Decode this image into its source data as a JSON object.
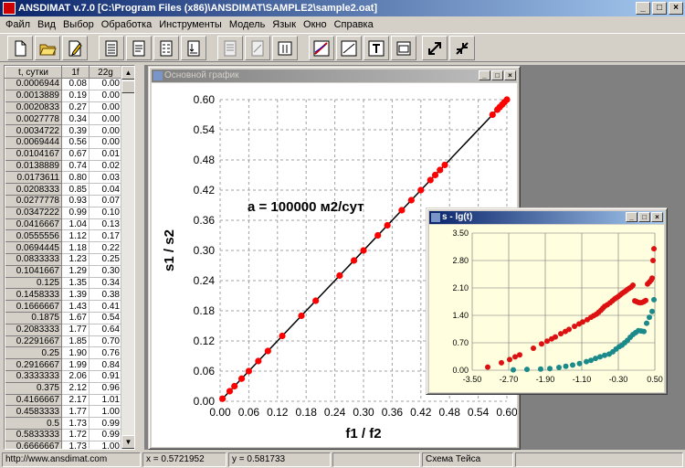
{
  "app": {
    "title": "ANSDIMAT v.7.0  [C:\\Program Files (x86)\\ANSDIMAT\\SAMPLE2\\sample2.oat]",
    "window_buttons": {
      "minimize": "_",
      "maximize": "□",
      "close": "×"
    }
  },
  "menu": [
    "Файл",
    "Вид",
    "Выбор",
    "Обработка",
    "Инструменты",
    "Модель",
    "Язык",
    "Окно",
    "Справка"
  ],
  "toolbar": {
    "buttons": [
      {
        "icon": "new-file-icon"
      },
      {
        "icon": "open-folder-icon"
      },
      {
        "icon": "edit-icon"
      },
      {
        "icon": "table-icon"
      },
      {
        "icon": "doc-icon"
      },
      {
        "icon": "list-icon"
      },
      {
        "icon": "print-icon"
      },
      {
        "icon": "copy-icon"
      },
      {
        "icon": "format-icon"
      },
      {
        "icon": "columns-icon"
      },
      {
        "icon": "chart-icon"
      },
      {
        "icon": "line-icon"
      },
      {
        "icon": "text-icon"
      },
      {
        "icon": "window-icon"
      },
      {
        "icon": "expand-icon"
      },
      {
        "icon": "shrink-icon"
      }
    ]
  },
  "table": {
    "headers": [
      "t, сутки",
      "1f",
      "22g"
    ],
    "rows": [
      [
        "0.0006944",
        "0.08",
        "0.00"
      ],
      [
        "0.0013889",
        "0.19",
        "0.00"
      ],
      [
        "0.0020833",
        "0.27",
        "0.00"
      ],
      [
        "0.0027778",
        "0.34",
        "0.00"
      ],
      [
        "0.0034722",
        "0.39",
        "0.00"
      ],
      [
        "0.0069444",
        "0.56",
        "0.00"
      ],
      [
        "0.0104167",
        "0.67",
        "0.01"
      ],
      [
        "0.0138889",
        "0.74",
        "0.02"
      ],
      [
        "0.0173611",
        "0.80",
        "0.03"
      ],
      [
        "0.0208333",
        "0.85",
        "0.04"
      ],
      [
        "0.0277778",
        "0.93",
        "0.07"
      ],
      [
        "0.0347222",
        "0.99",
        "0.10"
      ],
      [
        "0.0416667",
        "1.04",
        "0.13"
      ],
      [
        "0.0555556",
        "1.12",
        "0.17"
      ],
      [
        "0.0694445",
        "1.18",
        "0.22"
      ],
      [
        "0.0833333",
        "1.23",
        "0.25"
      ],
      [
        "0.1041667",
        "1.29",
        "0.30"
      ],
      [
        "0.125",
        "1.35",
        "0.34"
      ],
      [
        "0.1458333",
        "1.39",
        "0.38"
      ],
      [
        "0.1666667",
        "1.43",
        "0.41"
      ],
      [
        "0.1875",
        "1.67",
        "0.54"
      ],
      [
        "0.2083333",
        "1.77",
        "0.64"
      ],
      [
        "0.2291667",
        "1.85",
        "0.70"
      ],
      [
        "0.25",
        "1.90",
        "0.76"
      ],
      [
        "0.2916667",
        "1.99",
        "0.84"
      ],
      [
        "0.3333333",
        "2.06",
        "0.91"
      ],
      [
        "0.375",
        "2.12",
        "0.96"
      ],
      [
        "0.4166667",
        "2.17",
        "1.01"
      ],
      [
        "0.4583333",
        "1.77",
        "1.00"
      ],
      [
        "0.5",
        "1.73",
        "0.99"
      ],
      [
        "0.5833333",
        "1.72",
        "0.99"
      ],
      [
        "0.6666667",
        "1.73",
        "1.00"
      ],
      [
        "0.75",
        "1.75",
        "1.02"
      ]
    ]
  },
  "main_chart_window": {
    "title": "Основной график"
  },
  "inset_window": {
    "title": "s - lg(t)"
  },
  "chart_data": [
    {
      "type": "scatter",
      "title": "",
      "annotation": "a = 100000 м2/сут",
      "xlabel": "f1 / f2",
      "ylabel": "s1 / s2",
      "xlim": [
        0.0,
        0.6
      ],
      "ylim": [
        0.0,
        0.6
      ],
      "xticks": [
        "0.00",
        "0.06",
        "0.12",
        "0.18",
        "0.24",
        "0.30",
        "0.36",
        "0.42",
        "0.48",
        "0.54",
        "0.60"
      ],
      "yticks": [
        "0.00",
        "0.06",
        "0.12",
        "0.18",
        "0.24",
        "0.30",
        "0.36",
        "0.42",
        "0.48",
        "0.54",
        "0.60"
      ],
      "grid": true,
      "line": {
        "x": [
          0.0,
          0.6
        ],
        "y": [
          0.0,
          0.6
        ]
      },
      "points": {
        "x": [
          0.005,
          0.02,
          0.03,
          0.045,
          0.06,
          0.08,
          0.1,
          0.13,
          0.17,
          0.2,
          0.25,
          0.28,
          0.3,
          0.33,
          0.35,
          0.38,
          0.4,
          0.42,
          0.44,
          0.45,
          0.46,
          0.47,
          0.57,
          0.58,
          0.585,
          0.59,
          0.595,
          0.6
        ],
        "y": [
          0.005,
          0.02,
          0.03,
          0.045,
          0.06,
          0.08,
          0.1,
          0.13,
          0.17,
          0.2,
          0.25,
          0.28,
          0.3,
          0.33,
          0.35,
          0.38,
          0.4,
          0.42,
          0.44,
          0.45,
          0.46,
          0.47,
          0.57,
          0.58,
          0.585,
          0.59,
          0.595,
          0.6
        ]
      },
      "colors": {
        "points": "#ff0000",
        "line": "#000000"
      }
    },
    {
      "type": "scatter",
      "title": "s - lg(t)",
      "xlim": [
        -3.5,
        0.5
      ],
      "ylim": [
        0.0,
        3.5
      ],
      "xticks": [
        "-3.50",
        "-2.70",
        "-1.90",
        "-1.10",
        "-0.30",
        "0.50"
      ],
      "yticks": [
        "0.00",
        "0.70",
        "1.40",
        "2.10",
        "2.80",
        "3.50"
      ],
      "grid": true,
      "series": [
        {
          "color": "#dd1111",
          "x": [
            -3.16,
            -2.86,
            -2.68,
            -2.56,
            -2.46,
            -2.16,
            -1.98,
            -1.86,
            -1.76,
            -1.68,
            -1.56,
            -1.46,
            -1.38,
            -1.26,
            -1.16,
            -1.08,
            -0.98,
            -0.9,
            -0.84,
            -0.78,
            -0.73,
            -0.68,
            -0.64,
            -0.6,
            -0.54,
            -0.48,
            -0.43,
            -0.38,
            -0.34,
            -0.3,
            -0.26,
            -0.22,
            -0.18,
            -0.14,
            -0.1,
            -0.06,
            -0.02,
            0.02,
            0.06,
            0.1,
            0.14,
            0.18,
            0.22,
            0.26,
            0.3,
            0.34,
            0.38,
            0.42,
            0.44,
            0.46,
            0.48
          ],
          "y": [
            0.08,
            0.19,
            0.27,
            0.34,
            0.39,
            0.56,
            0.67,
            0.74,
            0.8,
            0.85,
            0.93,
            0.99,
            1.04,
            1.12,
            1.18,
            1.23,
            1.29,
            1.35,
            1.39,
            1.43,
            1.48,
            1.53,
            1.58,
            1.63,
            1.67,
            1.72,
            1.77,
            1.82,
            1.85,
            1.88,
            1.92,
            1.96,
            1.99,
            2.02,
            2.06,
            2.09,
            2.12,
            2.17,
            1.77,
            1.75,
            1.73,
            1.72,
            1.73,
            1.75,
            1.78,
            2.2,
            2.25,
            2.3,
            2.35,
            2.8,
            3.1
          ]
        },
        {
          "color": "#1a8a8a",
          "x": [
            -2.6,
            -2.3,
            -2.0,
            -1.8,
            -1.6,
            -1.45,
            -1.3,
            -1.15,
            -1.0,
            -0.9,
            -0.8,
            -0.7,
            -0.6,
            -0.5,
            -0.42,
            -0.35,
            -0.28,
            -0.22,
            -0.16,
            -0.1,
            -0.04,
            0.02,
            0.08,
            0.14,
            0.2,
            0.26,
            0.32,
            0.38,
            0.44,
            0.48
          ],
          "y": [
            0.01,
            0.02,
            0.03,
            0.04,
            0.07,
            0.1,
            0.13,
            0.17,
            0.22,
            0.25,
            0.3,
            0.34,
            0.38,
            0.41,
            0.47,
            0.54,
            0.6,
            0.64,
            0.7,
            0.76,
            0.84,
            0.91,
            0.96,
            1.01,
            1.0,
            0.99,
            1.2,
            1.35,
            1.5,
            1.8
          ]
        }
      ]
    }
  ],
  "status": {
    "url": "http://www.ansdimat.com",
    "x": "x = 0.5721952",
    "y": "y = 0.581733",
    "model": "Схема Тейса"
  }
}
